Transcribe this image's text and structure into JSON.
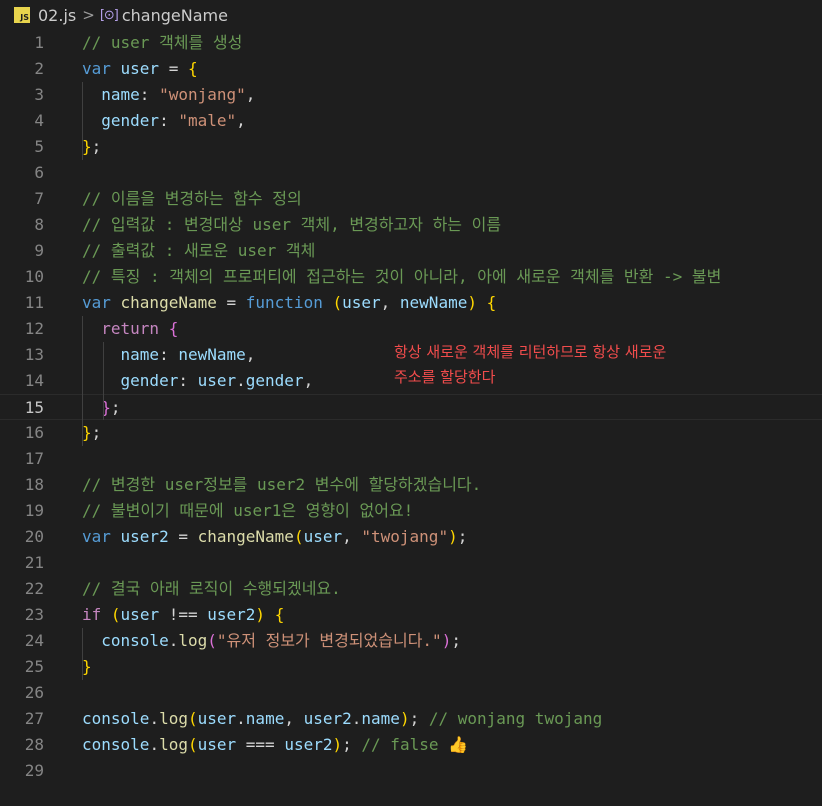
{
  "breadcrumb": {
    "file_badge": "JS",
    "file_name": "02.js",
    "separator": ">",
    "symbol_icon": "symbol-method-icon",
    "symbol_name": "changeName"
  },
  "editor": {
    "current_line": 15,
    "lines": [
      {
        "n": "1",
        "tokens": [
          {
            "t": "// user 객체를 생성",
            "c": "cm"
          }
        ]
      },
      {
        "n": "2",
        "tokens": [
          {
            "t": "var ",
            "c": "kw"
          },
          {
            "t": "user",
            "c": "var"
          },
          {
            "t": " = ",
            "c": "p"
          },
          {
            "t": "{",
            "c": "b1"
          }
        ]
      },
      {
        "n": "3",
        "tokens": [
          {
            "t": "  name",
            "c": "var"
          },
          {
            "t": ": ",
            "c": "p"
          },
          {
            "t": "\"wonjang\"",
            "c": "str"
          },
          {
            "t": ",",
            "c": "p"
          }
        ]
      },
      {
        "n": "4",
        "tokens": [
          {
            "t": "  gender",
            "c": "var"
          },
          {
            "t": ": ",
            "c": "p"
          },
          {
            "t": "\"male\"",
            "c": "str"
          },
          {
            "t": ",",
            "c": "p"
          }
        ]
      },
      {
        "n": "5",
        "tokens": [
          {
            "t": "}",
            "c": "b1"
          },
          {
            "t": ";",
            "c": "p"
          }
        ]
      },
      {
        "n": "6",
        "tokens": []
      },
      {
        "n": "7",
        "tokens": [
          {
            "t": "// 이름을 변경하는 함수 정의",
            "c": "cm"
          }
        ]
      },
      {
        "n": "8",
        "tokens": [
          {
            "t": "// 입력값 : 변경대상 user 객체, 변경하고자 하는 이름",
            "c": "cm"
          }
        ]
      },
      {
        "n": "9",
        "tokens": [
          {
            "t": "// 출력값 : 새로운 user 객체",
            "c": "cm"
          }
        ]
      },
      {
        "n": "10",
        "tokens": [
          {
            "t": "// 특징 : 객체의 프로퍼티에 접근하는 것이 아니라, 아에 새로운 객체를 반환 -> 불변",
            "c": "cm"
          }
        ]
      },
      {
        "n": "11",
        "tokens": [
          {
            "t": "var ",
            "c": "kw"
          },
          {
            "t": "changeName",
            "c": "fn"
          },
          {
            "t": " = ",
            "c": "p"
          },
          {
            "t": "function",
            "c": "kw"
          },
          {
            "t": " ",
            "c": "p"
          },
          {
            "t": "(",
            "c": "b1"
          },
          {
            "t": "user",
            "c": "var"
          },
          {
            "t": ", ",
            "c": "p"
          },
          {
            "t": "newName",
            "c": "var"
          },
          {
            "t": ")",
            "c": "b1"
          },
          {
            "t": " ",
            "c": "p"
          },
          {
            "t": "{",
            "c": "b1"
          }
        ]
      },
      {
        "n": "12",
        "tokens": [
          {
            "t": "  return",
            "c": "ctl"
          },
          {
            "t": " ",
            "c": "p"
          },
          {
            "t": "{",
            "c": "b2"
          }
        ]
      },
      {
        "n": "13",
        "tokens": [
          {
            "t": "    name",
            "c": "var"
          },
          {
            "t": ": ",
            "c": "p"
          },
          {
            "t": "newName",
            "c": "var"
          },
          {
            "t": ",",
            "c": "p"
          }
        ]
      },
      {
        "n": "14",
        "tokens": [
          {
            "t": "    gender",
            "c": "var"
          },
          {
            "t": ": ",
            "c": "p"
          },
          {
            "t": "user",
            "c": "var"
          },
          {
            "t": ".",
            "c": "p"
          },
          {
            "t": "gender",
            "c": "var"
          },
          {
            "t": ",",
            "c": "p"
          }
        ]
      },
      {
        "n": "15",
        "tokens": [
          {
            "t": "  }",
            "c": "b2"
          },
          {
            "t": ";",
            "c": "p"
          }
        ]
      },
      {
        "n": "16",
        "tokens": [
          {
            "t": "}",
            "c": "b1"
          },
          {
            "t": ";",
            "c": "p"
          }
        ]
      },
      {
        "n": "17",
        "tokens": []
      },
      {
        "n": "18",
        "tokens": [
          {
            "t": "// 변경한 user정보를 user2 변수에 할당하겠습니다.",
            "c": "cm"
          }
        ]
      },
      {
        "n": "19",
        "tokens": [
          {
            "t": "// 불변이기 때문에 user1은 영향이 없어요!",
            "c": "cm"
          }
        ]
      },
      {
        "n": "20",
        "tokens": [
          {
            "t": "var ",
            "c": "kw"
          },
          {
            "t": "user2",
            "c": "var"
          },
          {
            "t": " = ",
            "c": "p"
          },
          {
            "t": "changeName",
            "c": "fn"
          },
          {
            "t": "(",
            "c": "b1"
          },
          {
            "t": "user",
            "c": "var"
          },
          {
            "t": ", ",
            "c": "p"
          },
          {
            "t": "\"twojang\"",
            "c": "str"
          },
          {
            "t": ")",
            "c": "b1"
          },
          {
            "t": ";",
            "c": "p"
          }
        ]
      },
      {
        "n": "21",
        "tokens": []
      },
      {
        "n": "22",
        "tokens": [
          {
            "t": "// 결국 아래 로직이 수행되겠네요.",
            "c": "cm"
          }
        ]
      },
      {
        "n": "23",
        "tokens": [
          {
            "t": "if",
            "c": "ctl"
          },
          {
            "t": " ",
            "c": "p"
          },
          {
            "t": "(",
            "c": "b1"
          },
          {
            "t": "user",
            "c": "var"
          },
          {
            "t": " !== ",
            "c": "p"
          },
          {
            "t": "user2",
            "c": "var"
          },
          {
            "t": ")",
            "c": "b1"
          },
          {
            "t": " ",
            "c": "p"
          },
          {
            "t": "{",
            "c": "b1"
          }
        ]
      },
      {
        "n": "24",
        "tokens": [
          {
            "t": "  console",
            "c": "var"
          },
          {
            "t": ".",
            "c": "p"
          },
          {
            "t": "log",
            "c": "fn"
          },
          {
            "t": "(",
            "c": "b2"
          },
          {
            "t": "\"유저 정보가 변경되었습니다.\"",
            "c": "str"
          },
          {
            "t": ")",
            "c": "b2"
          },
          {
            "t": ";",
            "c": "p"
          }
        ]
      },
      {
        "n": "25",
        "tokens": [
          {
            "t": "}",
            "c": "b1"
          }
        ]
      },
      {
        "n": "26",
        "tokens": []
      },
      {
        "n": "27",
        "tokens": [
          {
            "t": "console",
            "c": "var"
          },
          {
            "t": ".",
            "c": "p"
          },
          {
            "t": "log",
            "c": "fn"
          },
          {
            "t": "(",
            "c": "b1"
          },
          {
            "t": "user",
            "c": "var"
          },
          {
            "t": ".",
            "c": "p"
          },
          {
            "t": "name",
            "c": "var"
          },
          {
            "t": ", ",
            "c": "p"
          },
          {
            "t": "user2",
            "c": "var"
          },
          {
            "t": ".",
            "c": "p"
          },
          {
            "t": "name",
            "c": "var"
          },
          {
            "t": ")",
            "c": "b1"
          },
          {
            "t": "; ",
            "c": "p"
          },
          {
            "t": "// wonjang twojang",
            "c": "cm"
          }
        ]
      },
      {
        "n": "28",
        "tokens": [
          {
            "t": "console",
            "c": "var"
          },
          {
            "t": ".",
            "c": "p"
          },
          {
            "t": "log",
            "c": "fn"
          },
          {
            "t": "(",
            "c": "b1"
          },
          {
            "t": "user",
            "c": "var"
          },
          {
            "t": " === ",
            "c": "p"
          },
          {
            "t": "user2",
            "c": "var"
          },
          {
            "t": ")",
            "c": "b1"
          },
          {
            "t": "; ",
            "c": "p"
          },
          {
            "t": "// false ",
            "c": "cm"
          },
          {
            "t": "👍",
            "c": "emoji"
          }
        ]
      },
      {
        "n": "29",
        "tokens": []
      }
    ]
  },
  "annotation": {
    "line1": "항상 새로운 객체를 리턴하므로 항상 새로운",
    "line2": "주소를 할당한다"
  }
}
